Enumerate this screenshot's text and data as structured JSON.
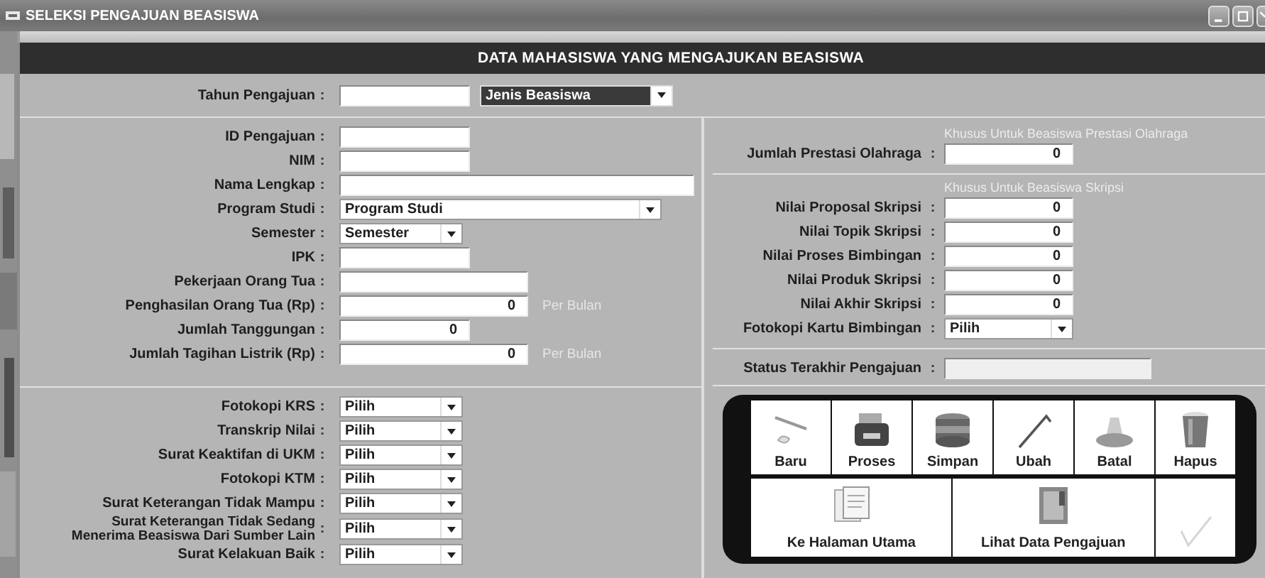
{
  "window": {
    "title": "SELEKSI PENGAJUAN BEASISWA"
  },
  "header": "DATA MAHASISWA YANG MENGAJUKAN BEASISWA",
  "tahun_pengajuan": {
    "label": "Tahun Pengajuan",
    "colon": ":"
  },
  "jenis_beasiswa": {
    "value": "Jenis Beasiswa",
    "focused": true
  },
  "student_fields": [
    {
      "label": "ID Pengajuan",
      "colon": ":",
      "kind": "text"
    },
    {
      "label": "NIM",
      "colon": ":",
      "kind": "text"
    },
    {
      "label": "Nama Lengkap",
      "colon": ":",
      "kind": "text"
    },
    {
      "label": "Program Studi",
      "colon": ":",
      "kind": "select",
      "value": "Program Studi"
    },
    {
      "label": "Semester",
      "colon": ":",
      "kind": "select",
      "value": "Semester"
    },
    {
      "label": "IPK",
      "colon": ":",
      "kind": "text"
    },
    {
      "label": "Pekerjaan Orang Tua",
      "colon": ":",
      "kind": "text"
    },
    {
      "label": "Penghasilan Orang Tua (Rp)",
      "colon": ":",
      "kind": "number",
      "value": "0",
      "suffix": "Per Bulan"
    },
    {
      "label": "Jumlah Tanggungan",
      "colon": ":",
      "kind": "number",
      "value": "0"
    },
    {
      "label": "Jumlah Tagihan Listrik (Rp)",
      "colon": ":",
      "kind": "number",
      "value": "0",
      "suffix": "Per Bulan"
    }
  ],
  "documents": [
    {
      "label": "Fotokopi KRS",
      "colon": ":",
      "kind": "select",
      "value": "Pilih"
    },
    {
      "label": "Transkrip Nilai",
      "colon": ":",
      "kind": "select",
      "value": "Pilih"
    },
    {
      "label": "Surat Keaktifan di UKM",
      "colon": ":",
      "kind": "select",
      "value": "Pilih"
    },
    {
      "label": "Fotokopi KTM",
      "colon": ":",
      "kind": "select",
      "value": "Pilih"
    },
    {
      "label": "Surat Keterangan Tidak Mampu",
      "colon": ":",
      "kind": "select",
      "value": "Pilih"
    },
    {
      "label": "Surat Keterangan Tidak Sedang\nMenerima Beasiswa Dari Sumber Lain",
      "colon": ":",
      "kind": "select",
      "value": "Pilih"
    },
    {
      "label": "Surat Kelakuan Baik",
      "colon": ":",
      "kind": "select",
      "value": "Pilih"
    }
  ],
  "prestasi": {
    "note": "Khusus Untuk Beasiswa Prestasi Olahraga",
    "fields": [
      {
        "label": "Jumlah Prestasi Olahraga",
        "colon": ":",
        "kind": "number",
        "value": "0"
      }
    ]
  },
  "skripsi": {
    "note": "Khusus Untuk Beasiswa Skripsi",
    "fields": [
      {
        "label": "Nilai Proposal Skripsi",
        "colon": ":",
        "kind": "number",
        "value": "0"
      },
      {
        "label": "Nilai Topik Skripsi",
        "colon": ":",
        "kind": "number",
        "value": "0"
      },
      {
        "label": "Nilai Proses Bimbingan",
        "colon": ":",
        "kind": "number",
        "value": "0"
      },
      {
        "label": "Nilai Produk Skripsi",
        "colon": ":",
        "kind": "number",
        "value": "0"
      },
      {
        "label": "Nilai Akhir Skripsi",
        "colon": ":",
        "kind": "number",
        "value": "0"
      },
      {
        "label": "Fotokopi Kartu Bimbingan",
        "colon": ":",
        "kind": "select",
        "value": "Pilih"
      }
    ]
  },
  "status": {
    "label": "Status Terakhir Pengajuan",
    "colon": ":"
  },
  "action_buttons": [
    {
      "label": "Baru"
    },
    {
      "label": "Proses"
    },
    {
      "label": "Simpan"
    },
    {
      "label": "Ubah"
    },
    {
      "label": "Batal"
    },
    {
      "label": "Hapus"
    }
  ],
  "nav_buttons": [
    {
      "label": "Ke Halaman Utama",
      "disabled": false
    },
    {
      "label": "Lihat Data Pengajuan",
      "disabled": false
    },
    {
      "disabled": true
    }
  ]
}
